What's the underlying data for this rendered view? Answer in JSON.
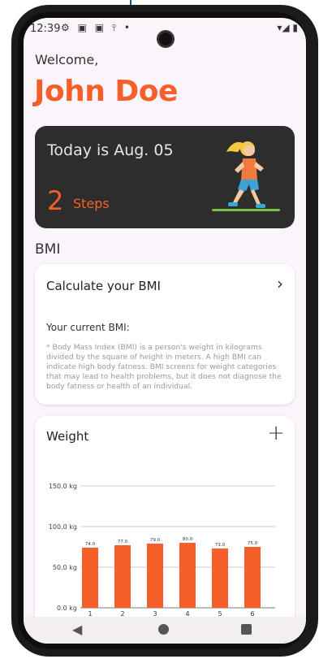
{
  "status_bar": {
    "time": "12:39",
    "icons": "⚙ ▣ ▣ ⫯ •",
    "right_icons": "▾◢ ▮"
  },
  "header": {
    "welcome": "Welcome,",
    "name": "John Doe",
    "accent_color": "#f45f2a"
  },
  "steps_card": {
    "date_text": "Today is Aug. 05",
    "steps_count": "2",
    "steps_label": "Steps",
    "illustration": "running-girl-illustration"
  },
  "bmi": {
    "section_title": "BMI",
    "calculate_label": "Calculate your BMI",
    "chevron_icon": "chevron-right-icon",
    "current_label": "Your current BMI:",
    "description": "* Body Mass Index (BMI) is a person's weight in kilograms divided by the square of height in meters. A high BMI can indicate high body fatness. BMI screens for weight categories that may lead to health problems, but it does not diagnose the body fatness or health of an individual."
  },
  "weight": {
    "title": "Weight",
    "add_icon": "plus-icon"
  },
  "chart_data": {
    "type": "bar",
    "categories": [
      "1",
      "2",
      "3",
      "4",
      "5",
      "6"
    ],
    "series": [
      {
        "name": "Weight",
        "values": [
          74.0,
          77.0,
          79.0,
          80.0,
          73.0,
          75.0
        ],
        "labels": [
          "74.0",
          "77.0",
          "79.0",
          "80.0",
          "73.0",
          "75.0"
        ]
      }
    ],
    "ylim": [
      0,
      150
    ],
    "y_ticks": [
      "0.0 kg",
      "50.0 kg",
      "100.0 kg",
      "150.0 kg"
    ],
    "y_tick_values": [
      0,
      50,
      100,
      150
    ],
    "bar_color": "#f45f2a",
    "grid": true,
    "legend": "bottom-left"
  },
  "nav_bar": {
    "back_icon": "back-triangle-icon",
    "home_icon": "home-circle-icon",
    "recents_icon": "recents-square-icon"
  }
}
